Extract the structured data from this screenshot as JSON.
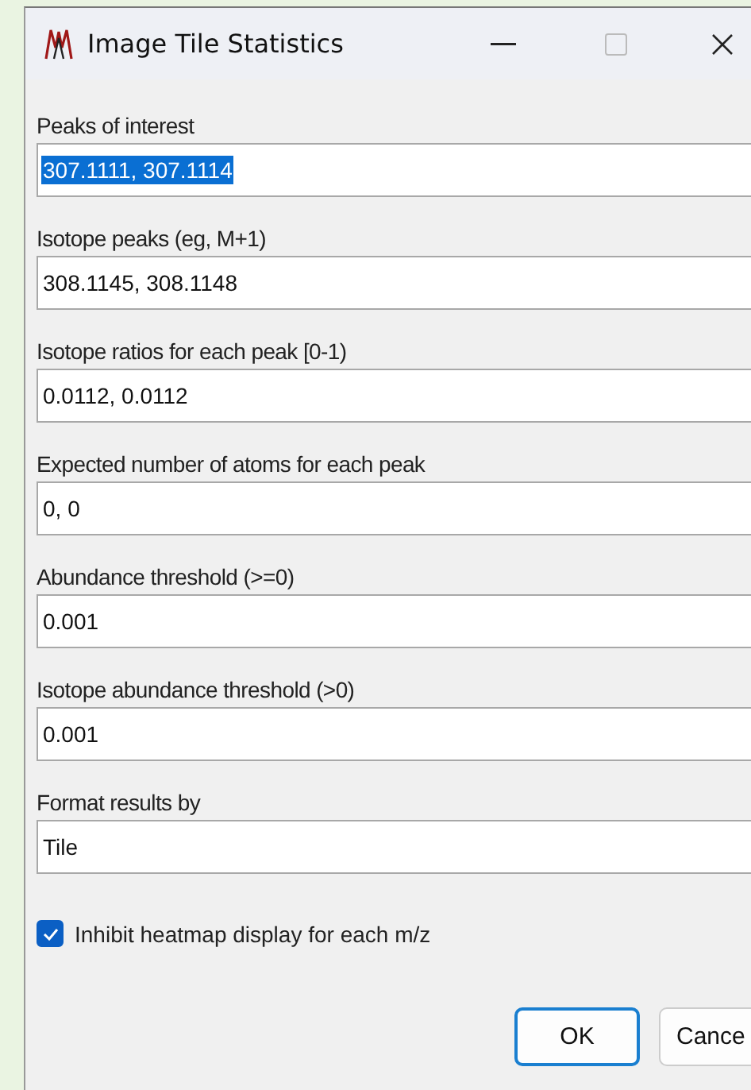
{
  "window": {
    "title": "Image Tile Statistics"
  },
  "fields": [
    {
      "label": "Peaks of interest",
      "value": "307.1111, 307.1114",
      "text_selected": true
    },
    {
      "label": "Isotope peaks (eg, M+1)",
      "value": "308.1145, 308.1148",
      "text_selected": false
    },
    {
      "label": "Isotope ratios for each peak [0-1)",
      "value": "0.0112, 0.0112",
      "text_selected": false
    },
    {
      "label": "Expected number of atoms for each peak",
      "value": "0, 0",
      "text_selected": false
    },
    {
      "label": "Abundance threshold (>=0)",
      "value": "0.001",
      "text_selected": false
    },
    {
      "label": "Isotope abundance threshold (>0)",
      "value": "0.001",
      "text_selected": false
    },
    {
      "label": "Format results by",
      "value": "Tile",
      "text_selected": false
    }
  ],
  "checkbox": {
    "label": "Inhibit heatmap display for each m/z",
    "checked": true
  },
  "buttons": [
    {
      "label": "OK",
      "default": true
    },
    {
      "label": "Cance",
      "default": false
    }
  ]
}
